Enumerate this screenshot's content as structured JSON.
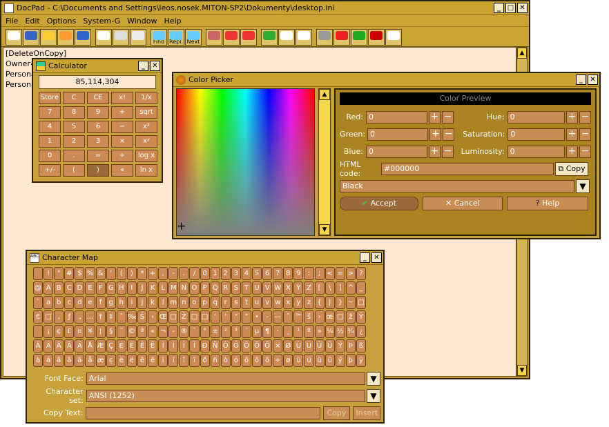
{
  "docpad": {
    "title": "DocPad - C:\\Documents and Settings\\leos.nosek.MITON-SP2\\Dokumenty\\desktop.ini",
    "menu": [
      "File",
      "Edit",
      "Options",
      "System-G",
      "Window",
      "Help"
    ],
    "toolbar": [
      {
        "icon": "new-icon",
        "label": ""
      },
      {
        "icon": "open-icon",
        "label": ""
      },
      {
        "icon": "save-icon",
        "label": ""
      },
      {
        "icon": "save-all-icon",
        "label": ""
      },
      {
        "icon": "reload-icon",
        "label": ""
      },
      {
        "icon": "cut-icon",
        "label": ""
      },
      {
        "icon": "copy-icon",
        "label": ""
      },
      {
        "icon": "paste-icon",
        "label": ""
      },
      {
        "icon": "find-icon",
        "label": "Find"
      },
      {
        "icon": "replace-icon",
        "label": "Repl."
      },
      {
        "icon": "find-next-icon",
        "label": "Next"
      },
      {
        "icon": "eraser-icon",
        "label": ""
      },
      {
        "icon": "bookmark-icon",
        "label": ""
      },
      {
        "icon": "next-bookmark-icon",
        "label": ""
      },
      {
        "icon": "calculator-icon",
        "label": ""
      },
      {
        "icon": "color-grid-icon",
        "label": ""
      },
      {
        "icon": "character-map-icon",
        "label": ""
      },
      {
        "icon": "macro-icon",
        "label": ""
      },
      {
        "icon": "record-icon",
        "label": ""
      },
      {
        "icon": "play-icon",
        "label": ""
      },
      {
        "icon": "spellcheck-icon",
        "label": ""
      },
      {
        "icon": "chart-icon",
        "label": ""
      }
    ],
    "lines": [
      "[DeleteOnCopy]",
      "Owner=",
      "Persona",
      "Persona"
    ]
  },
  "calculator": {
    "title": "Calculator",
    "display": "85,114,304",
    "keys": [
      "Store",
      "C",
      "CE",
      "x!",
      "1/x",
      "7",
      "8",
      "9",
      "+",
      "sqrt",
      "4",
      "5",
      "6",
      "−",
      "x²",
      "1",
      "2",
      "3",
      "×",
      "xʸ",
      "0",
      ".",
      "=",
      "÷",
      "log x",
      "+/-",
      "(",
      ")",
      "«",
      "ln x"
    ]
  },
  "color_picker": {
    "title": "Color Picker",
    "preview_label": "Color Preview",
    "red_label": "Red:",
    "red": "0",
    "green_label": "Green:",
    "green": "0",
    "blue_label": "Blue:",
    "blue": "0",
    "hue_label": "Hue:",
    "hue": "0",
    "sat_label": "Saturation:",
    "sat": "0",
    "lum_label": "Luminosity:",
    "lum": "0",
    "html_label": "HTML code:",
    "html": "#000000",
    "copy_label": "Copy",
    "color_name": "Black",
    "accept_label": "Accept",
    "cancel_label": "Cancel",
    "help_label": "Help"
  },
  "charmap": {
    "title": "Character Map",
    "chars": [
      " ",
      "!",
      "\"",
      "#",
      "$",
      "%",
      "&",
      "'",
      "(",
      ")",
      "*",
      "+",
      ",",
      "-",
      ".",
      "/",
      "0",
      "1",
      "2",
      "3",
      "4",
      "5",
      "6",
      "7",
      "8",
      "9",
      ":",
      ";",
      "<",
      "=",
      ">",
      "?",
      "@",
      "A",
      "B",
      "C",
      "D",
      "E",
      "F",
      "G",
      "H",
      "I",
      "J",
      "K",
      "L",
      "M",
      "N",
      "O",
      "P",
      "Q",
      "R",
      "S",
      "T",
      "U",
      "V",
      "W",
      "X",
      "Y",
      "Z",
      "[",
      "\\",
      "]",
      "^",
      "_",
      "`",
      "a",
      "b",
      "c",
      "d",
      "e",
      "f",
      "g",
      "h",
      "i",
      "j",
      "k",
      "l",
      "m",
      "n",
      "o",
      "p",
      "q",
      "r",
      "s",
      "t",
      "u",
      "v",
      "w",
      "x",
      "y",
      "z",
      "{",
      "|",
      "}",
      "~",
      "□",
      "€",
      "□",
      "‚",
      "ƒ",
      "„",
      "…",
      "†",
      "‡",
      "ˆ",
      "‰",
      "Š",
      "‹",
      "Œ",
      "□",
      "Ž",
      "□",
      "□",
      "‘",
      "’",
      "“",
      "”",
      "•",
      "–",
      "—",
      "˜",
      "™",
      "š",
      "›",
      "œ",
      "□",
      "ž",
      "Ÿ",
      " ",
      "¡",
      "¢",
      "£",
      "¤",
      "¥",
      "¦",
      "§",
      "¨",
      "©",
      "ª",
      "«",
      "¬",
      "-",
      "®",
      "¯",
      "°",
      "±",
      "²",
      "³",
      "´",
      "µ",
      "¶",
      "·",
      "¸",
      "¹",
      "º",
      "»",
      "¼",
      "½",
      "¾",
      "¿",
      "À",
      "Á",
      "Â",
      "Ã",
      "Ä",
      "Å",
      "Æ",
      "Ç",
      "È",
      "É",
      "Ê",
      "Ë",
      "Ì",
      "Í",
      "Î",
      "Ï",
      "Ð",
      "Ñ",
      "Ò",
      "Ó",
      "Ô",
      "Õ",
      "Ö",
      "×",
      "Ø",
      "Ù",
      "Ú",
      "Û",
      "Ü",
      "Ý",
      "Þ",
      "ß",
      "à",
      "á",
      "â",
      "ã",
      "ä",
      "å",
      "æ",
      "ç",
      "è",
      "é",
      "ê",
      "ë",
      "ì",
      "í",
      "î",
      "ï",
      "ð",
      "ñ",
      "ò",
      "ó",
      "ô",
      "õ",
      "ö",
      "÷",
      "ø",
      "ù",
      "ú",
      "û",
      "ü",
      "ý",
      "þ",
      "ÿ"
    ],
    "font_label": "Font Face:",
    "font_value": "Arial",
    "charset_label": "Character set:",
    "charset_value": "ANSI (1252)",
    "copytext_label": "Copy Text:",
    "copytext_value": "",
    "copy_btn": "Copy",
    "insert_btn": "Insert"
  }
}
